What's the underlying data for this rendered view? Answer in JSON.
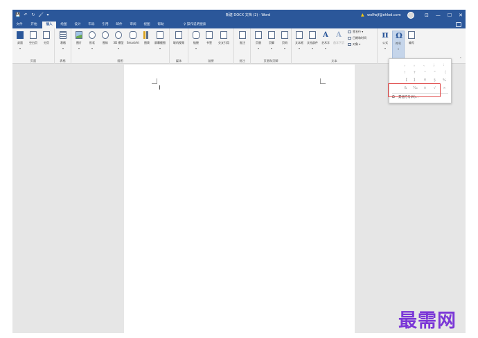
{
  "titlebar": {
    "quick_access": [
      "💾",
      "↶",
      "↻",
      "🖌",
      "▾"
    ],
    "doc_title": "新建 DOCX 文档 (2) - Word",
    "account": "wolfwjf@ehlod.com",
    "controls": [
      "⊡",
      "—",
      "☐",
      "✕"
    ]
  },
  "tabs": [
    {
      "label": "文件"
    },
    {
      "label": "开始"
    },
    {
      "label": "插入"
    },
    {
      "label": "绘图"
    },
    {
      "label": "设计"
    },
    {
      "label": "布局"
    },
    {
      "label": "引用"
    },
    {
      "label": "邮件"
    },
    {
      "label": "审阅"
    },
    {
      "label": "视图"
    },
    {
      "label": "帮助"
    }
  ],
  "active_tab": "插入",
  "tell_me": "操作说明搜索",
  "ribbon": {
    "groups": [
      {
        "label": "页面",
        "buttons": [
          "封面",
          "空白页",
          "分页"
        ]
      },
      {
        "label": "表格",
        "buttons": [
          "表格"
        ]
      },
      {
        "label": "插图",
        "buttons": [
          "图片",
          "形状",
          "图标",
          "3D 模型",
          "SmartArt",
          "图表",
          "屏幕截图"
        ]
      },
      {
        "label": "媒体",
        "buttons": [
          "联机视频"
        ]
      },
      {
        "label": "链接",
        "buttons": [
          "链接",
          "书签",
          "交叉引用"
        ]
      },
      {
        "label": "批注",
        "buttons": [
          "批注"
        ]
      },
      {
        "label": "页眉和页脚",
        "buttons": [
          "页眉",
          "页脚",
          "页码"
        ]
      },
      {
        "label": "文本",
        "buttons": [
          "文本框",
          "文档部件",
          "艺术字",
          "首字下沉"
        ],
        "small": [
          "签名行",
          "日期和时间",
          "对象"
        ]
      },
      {
        "label": "符号",
        "buttons": [
          "公式",
          "符号",
          "编号"
        ]
      }
    ]
  },
  "symbol_dropdown": {
    "rows": [
      [
        "，",
        "。",
        "、",
        "；",
        "："
      ],
      [
        "！",
        "？",
        "“",
        "”",
        "（"
      ],
      [
        "【",
        "】",
        "¥",
        "§",
        "%"
      ],
      [
        "&",
        "‰",
        "×",
        "√",
        "∞"
      ]
    ],
    "more_symbols": "其他符号(M)..."
  },
  "watermark": "最需网"
}
